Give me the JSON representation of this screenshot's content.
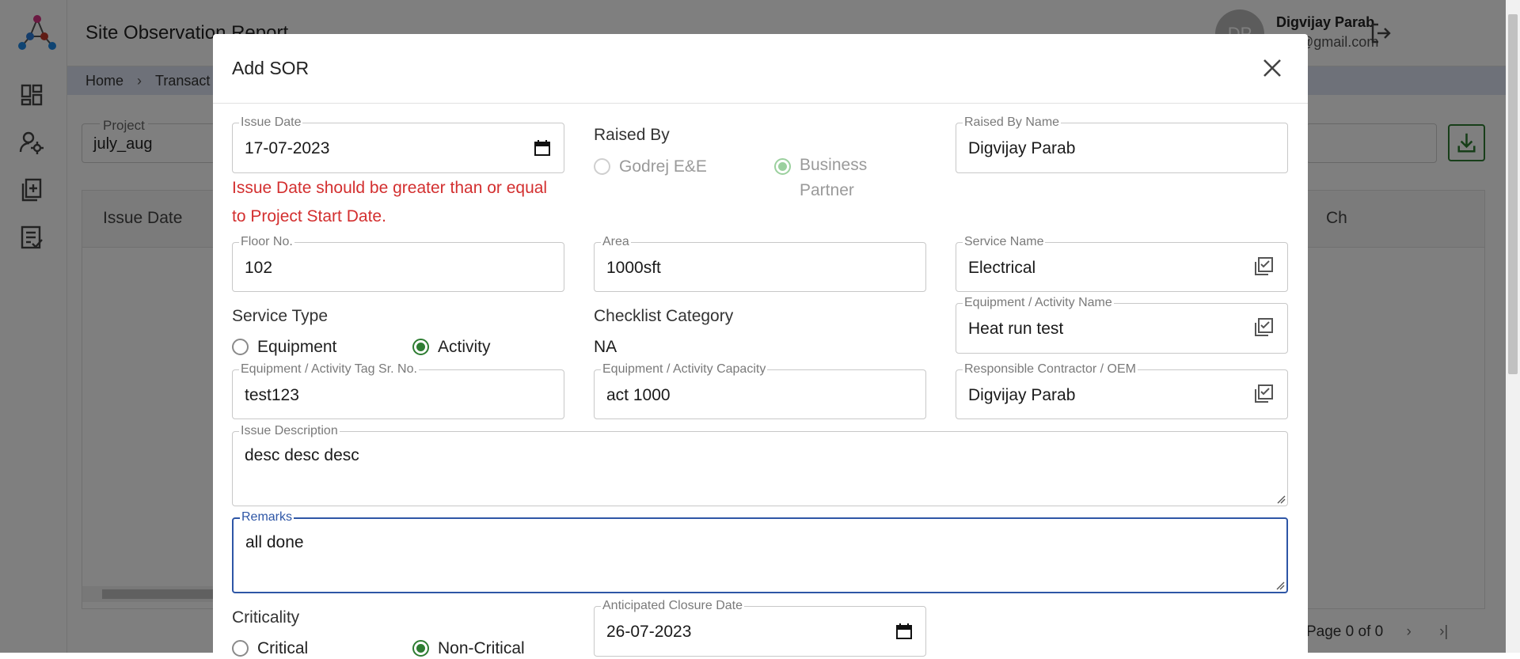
{
  "app": {
    "title": "Site Observation Report",
    "user_initials": "DP",
    "user_name": "Digvijay Parab",
    "user_email": "dsp@gmail.com"
  },
  "breadcrumb": [
    "Home",
    "Transact"
  ],
  "project": {
    "label": "Project",
    "value": "july_aug"
  },
  "grid": {
    "columns": [
      "Issue Date",
      "Ch"
    ],
    "pager": "Page 0 of 0"
  },
  "modal": {
    "title": "Add SOR",
    "issue_date": {
      "label": "Issue Date",
      "value": "17-07-2023"
    },
    "issue_date_error": "Issue Date should be greater than or equal to Project Start Date.",
    "raised_by": {
      "label": "Raised By",
      "options": [
        "Godrej E&E",
        "Business Partner"
      ],
      "selected": "Business Partner"
    },
    "raised_by_name": {
      "label": "Raised By Name",
      "value": "Digvijay Parab"
    },
    "floor_no": {
      "label": "Floor No.",
      "value": "102"
    },
    "area": {
      "label": "Area",
      "value": "1000sft"
    },
    "service_name": {
      "label": "Service Name",
      "value": "Electrical"
    },
    "service_type": {
      "label": "Service Type",
      "options": [
        "Equipment",
        "Activity"
      ],
      "selected": "Activity"
    },
    "checklist_category": {
      "label": "Checklist Category",
      "value": "NA"
    },
    "equipment_activity_name": {
      "label": "Equipment / Activity Name",
      "value": "Heat run test"
    },
    "tag_sr_no": {
      "label": "Equipment / Activity Tag Sr. No.",
      "value": "test123"
    },
    "capacity": {
      "label": "Equipment / Activity Capacity",
      "value": "act 1000"
    },
    "contractor": {
      "label": "Responsible Contractor / OEM",
      "value": "Digvijay Parab"
    },
    "issue_description": {
      "label": "Issue Description",
      "value": "desc desc desc"
    },
    "remarks": {
      "label": "Remarks",
      "value": "all done"
    },
    "criticality": {
      "label": "Criticality",
      "options": [
        "Critical",
        "Non-Critical"
      ],
      "selected": "Non-Critical"
    },
    "anticipated_closure_date": {
      "label": "Anticipated Closure Date",
      "value": "26-07-2023"
    }
  },
  "colors": {
    "accent_green": "#2e7d32",
    "error_red": "#d32f2f",
    "focus_blue": "#2e56a6",
    "breadcrumb_bg": "#dde3f3"
  }
}
